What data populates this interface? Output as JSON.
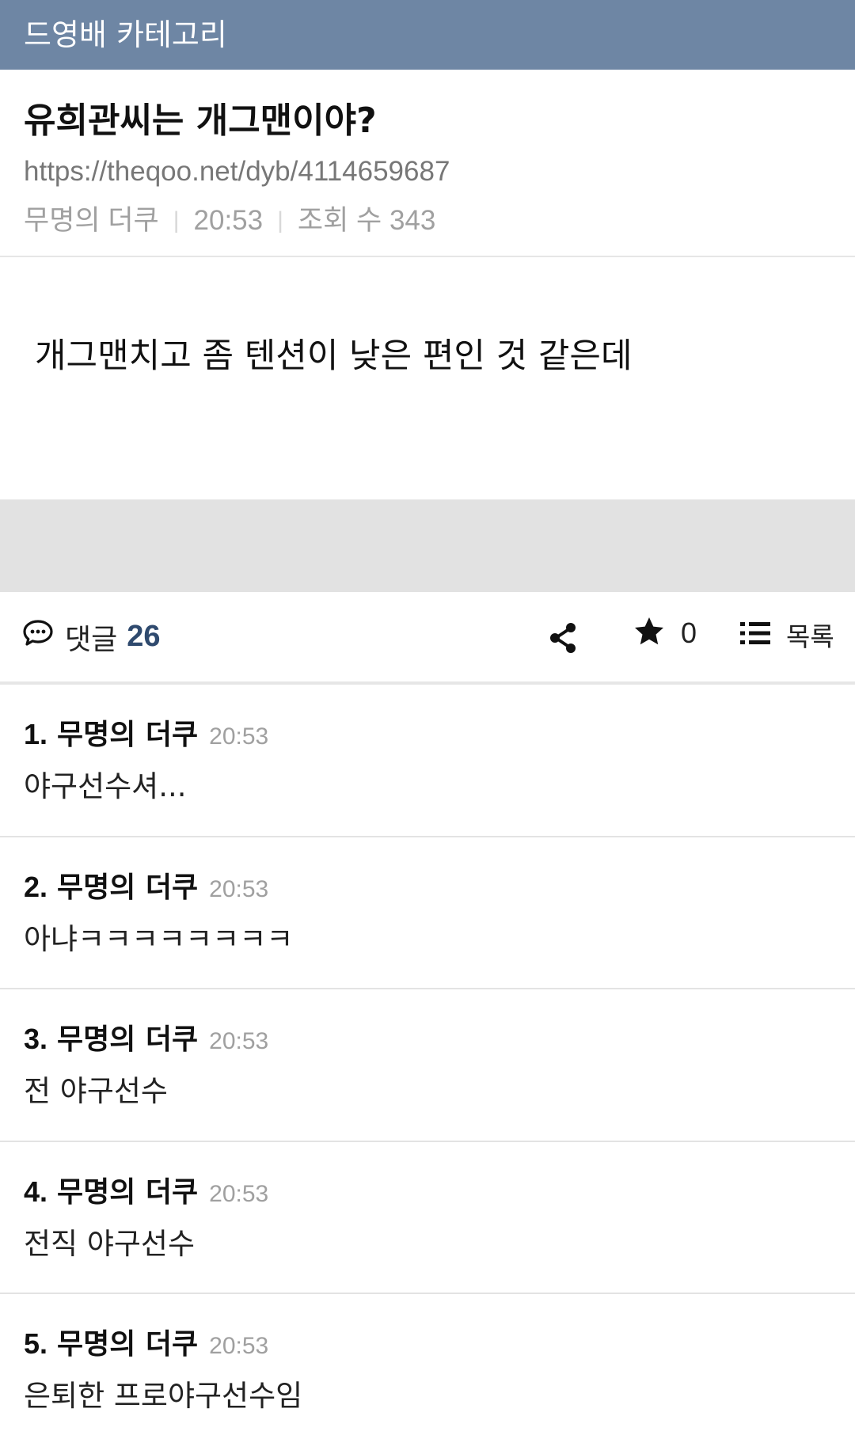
{
  "category": {
    "label": "드영배 카테고리"
  },
  "post": {
    "title": "유희관씨는 개그맨이야?",
    "url": "https://theqoo.net/dyb/4114659687",
    "author": "무명의 더쿠",
    "time": "20:53",
    "views": "조회 수 343",
    "body": "개그맨치고 좀 텐션이 낮은 편인 것 같은데"
  },
  "actions": {
    "comment_label": "댓글",
    "comment_count": "26",
    "star_count": "0",
    "list_label": "목록",
    "icons": [
      "comment-icon",
      "share-icon",
      "star-icon",
      "list-icon"
    ]
  },
  "comments": [
    {
      "num": "1.",
      "author": "무명의 더쿠",
      "time": "20:53",
      "text": "야구선수셔..."
    },
    {
      "num": "2.",
      "author": "무명의 더쿠",
      "time": "20:53",
      "text": "아냐ㅋㅋㅋㅋㅋㅋㅋㅋ"
    },
    {
      "num": "3.",
      "author": "무명의 더쿠",
      "time": "20:53",
      "text": "전 야구선수"
    },
    {
      "num": "4.",
      "author": "무명의 더쿠",
      "time": "20:53",
      "text": "전직 야구선수"
    },
    {
      "num": "5.",
      "author": "무명의 더쿠",
      "time": "20:53",
      "text": "은퇴한 프로야구선수임"
    }
  ],
  "colors": {
    "header_bg": "#6e86a4",
    "accent_count": "#2f4a6e",
    "band": "#e2e2e2"
  }
}
